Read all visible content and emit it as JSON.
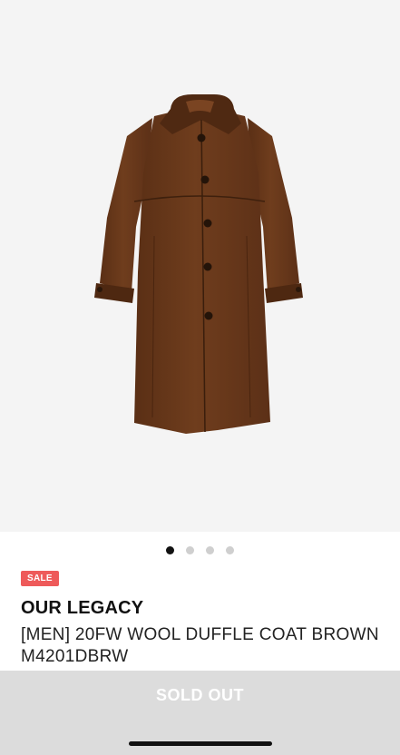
{
  "product": {
    "image_alt": "wool duffle coat brown",
    "badge": "SALE",
    "brand": "OUR LEGACY",
    "name": "[MEN] 20FW WOOL DUFFLE COAT BROWN M4201DBRW"
  },
  "carousel": {
    "count": 4,
    "active_index": 0
  },
  "cta": {
    "label": "SOLD OUT",
    "disabled": true
  },
  "colors": {
    "hero_bg": "#f4f4f4",
    "coat": "#6b3a1c",
    "badge_bg": "#ee5a5a",
    "cta_bg": "#dcdcdc"
  }
}
